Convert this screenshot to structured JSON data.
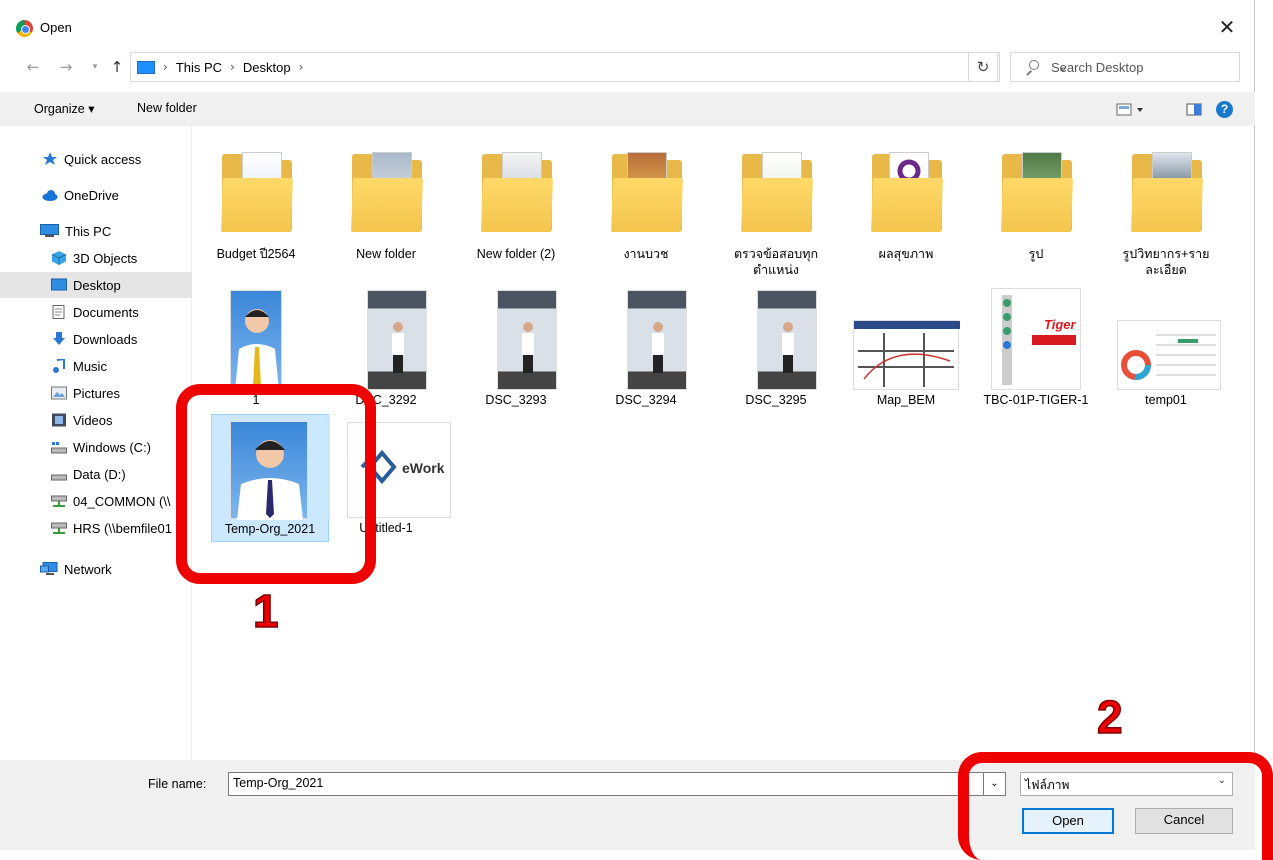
{
  "window": {
    "title": "Open"
  },
  "address": {
    "crumbs": [
      "This PC",
      "Desktop"
    ],
    "search_placeholder": "Search Desktop"
  },
  "toolbar": {
    "organize_label": "Organize ▾",
    "new_folder_label": "New folder"
  },
  "sidebar": {
    "items": [
      {
        "label": "Quick access",
        "icon": "star-icon"
      },
      {
        "label": "OneDrive",
        "icon": "cloud-icon"
      },
      {
        "label": "This PC",
        "icon": "computer-icon"
      },
      {
        "label": "3D Objects",
        "icon": "cube-icon"
      },
      {
        "label": "Desktop",
        "icon": "desktop-icon",
        "selected": true
      },
      {
        "label": "Documents",
        "icon": "document-icon"
      },
      {
        "label": "Downloads",
        "icon": "download-icon"
      },
      {
        "label": "Music",
        "icon": "music-icon"
      },
      {
        "label": "Pictures",
        "icon": "pictures-icon"
      },
      {
        "label": "Videos",
        "icon": "video-icon"
      },
      {
        "label": "Windows (C:)",
        "icon": "drive-icon"
      },
      {
        "label": "Data (D:)",
        "icon": "drive-icon"
      },
      {
        "label": "04_COMMON (\\\\",
        "icon": "network-drive-icon"
      },
      {
        "label": "HRS (\\\\bemfile01",
        "icon": "network-drive-icon"
      },
      {
        "label": "Network",
        "icon": "network-icon"
      }
    ]
  },
  "files": {
    "row1": [
      {
        "name": "Budget ปี2564",
        "kind": "folder"
      },
      {
        "name": "New folder",
        "kind": "folder"
      },
      {
        "name": "New folder (2)",
        "kind": "folder"
      },
      {
        "name": "งานบวช",
        "kind": "folder"
      },
      {
        "name": "ตรวจข้อสอบทุกตำแหน่ง",
        "kind": "folder"
      },
      {
        "name": "ผลสุขภาพ",
        "kind": "folder"
      },
      {
        "name": "รูป",
        "kind": "folder"
      },
      {
        "name": "รูปวิทยากร+รายละเอียด",
        "kind": "folder"
      }
    ],
    "row2": [
      {
        "name": "1",
        "kind": "portrait"
      },
      {
        "name": "DSC_3292",
        "kind": "photo"
      },
      {
        "name": "DSC_3293",
        "kind": "photo"
      },
      {
        "name": "DSC_3294",
        "kind": "photo"
      },
      {
        "name": "DSC_3295",
        "kind": "photo"
      },
      {
        "name": "Map_BEM",
        "kind": "map"
      },
      {
        "name": "TBC-01P-TIGER-1",
        "kind": "product"
      },
      {
        "name": "temp01",
        "kind": "doc"
      }
    ],
    "row3": [
      {
        "name": "Temp-Org_2021",
        "kind": "portrait",
        "selected": true
      },
      {
        "name": "Untitled-1",
        "kind": "logo",
        "logo_text": "eWork"
      }
    ]
  },
  "footer": {
    "file_name_label": "File name:",
    "file_name_value": "Temp-Org_2021",
    "file_type_value": "ไฟล์ภาพ",
    "open_label": "Open",
    "cancel_label": "Cancel"
  },
  "annotations": {
    "one": "1",
    "two": "2",
    "color": "#ee0000"
  }
}
